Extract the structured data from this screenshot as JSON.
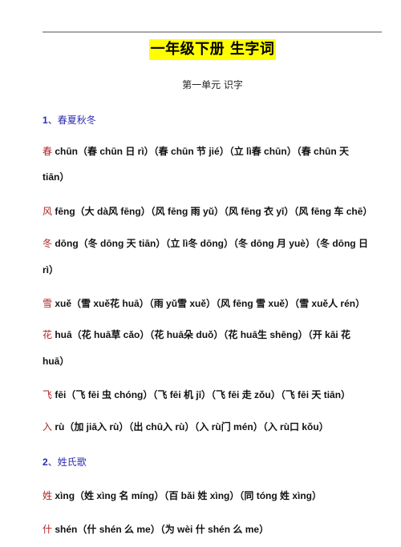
{
  "document": {
    "title": "一年级下册  生字词",
    "subtitle": "第一单元 识字",
    "accent_title_bg": "#ffff00",
    "section_color": "#2b2bb0",
    "char_color": "#b22222"
  },
  "sections": [
    {
      "number": "1",
      "sep": "、",
      "name": "春夏秋冬"
    },
    {
      "number": "2",
      "sep": "、",
      "name": "姓氏歌"
    }
  ],
  "lines": [
    {
      "char": "春",
      "text": " chūn（春 chūn 日 rì）（春 chūn 节 jié）（立 lì春 chūn）（春 chūn 天"
    },
    {
      "char": "",
      "text": "tiān）"
    },
    {
      "char": "风",
      "text": " fēng（大 dà风 fēng）（风 fēng 雨 yǔ）（风 fēng 衣 yī）（风 fēng 车 chē）"
    },
    {
      "char": "冬",
      "text": " dōng（冬 dōng 天 tiān）（立 lì冬 dōng）（冬 dōng 月 yuè）（冬 dōng 日"
    },
    {
      "char": "",
      "text": "rì）"
    },
    {
      "char": "雪",
      "text": " xuě（雪 xuě花 huā）（雨 yǔ雪 xuě）（风 fēng 雪 xuě）（雪 xuě人 rén）"
    },
    {
      "char": "花",
      "text": " huā（花 huā草 cǎo）（花 huā朵 duǒ）（花 huā生 shēng）（开 kāi 花"
    },
    {
      "char": "",
      "text": "huā）"
    },
    {
      "char": "飞",
      "text": " fēi（飞 fēi 虫 chóng）（飞 fēi 机 jī）（飞 fēi 走 zǒu）（飞 fēi 天 tiān）"
    },
    {
      "char": "入",
      "text": " rù（加 jiā入 rù）（出 chū入 rù）（入 rù门 mén）（入 rù口 kǒu）"
    },
    {
      "char": "姓",
      "text": " xìng（姓 xìng 名 míng）（百 bǎi 姓 xìng）（同 tóng 姓 xìng）"
    },
    {
      "char": "什",
      "text": " shén（什 shén 么 me）（为 wèi 什 shén 么 me）"
    }
  ]
}
